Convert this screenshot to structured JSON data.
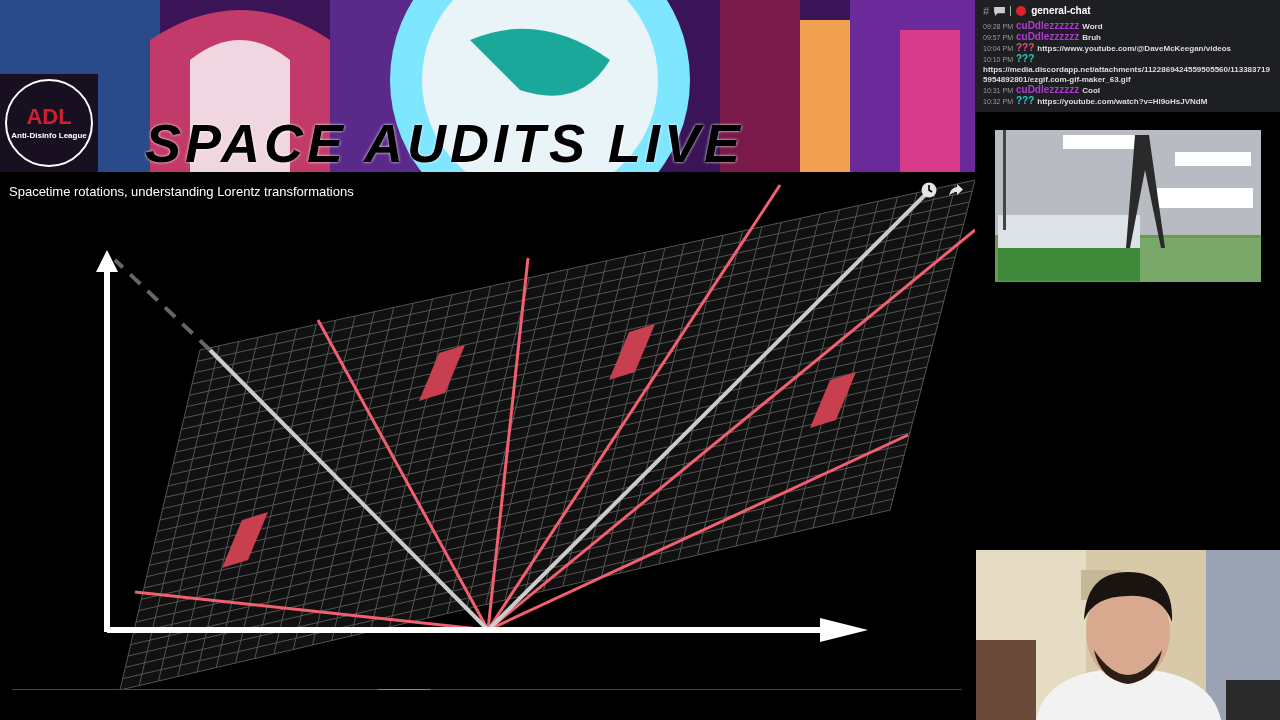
{
  "banner": {
    "logo": {
      "letters": "ADL",
      "caption": "Anti-Disinfo League"
    },
    "title": "SPACE AUDITS LIVE"
  },
  "video": {
    "title": "Spacetime rotations, understanding Lorentz transformations",
    "progress": {
      "level": 0.385
    }
  },
  "chat": {
    "prefix": "#",
    "channel": "general-chat",
    "messages": [
      {
        "kind": "inline",
        "time": "09:28 PM",
        "author": "cuDdlezzzzzz",
        "color": "#b13ad6",
        "text": "Word"
      },
      {
        "kind": "inline",
        "time": "09:57 PM",
        "author": "cuDdlezzzzzz",
        "color": "#b13ad6",
        "text": "Bruh"
      },
      {
        "kind": "inline",
        "time": "10:04 PM",
        "author": "???",
        "color": "#e0557a",
        "text": "https://www.youtube.com/@DaveMcKeegan/videos"
      },
      {
        "kind": "block",
        "time": "10:10 PM",
        "author": "???",
        "color": "#1fd1bd",
        "text": "https://media.discordapp.net/attachments/1122869424559505560/1133837195954892801/ezgif.com-gif-maker_63.gif"
      },
      {
        "kind": "inline",
        "time": "10:31 PM",
        "author": "cuDdlezzzzzz",
        "color": "#b13ad6",
        "text": "Cool"
      },
      {
        "kind": "inline",
        "time": "10:32 PM",
        "author": "???",
        "color": "#1fd1bd",
        "text": "https://youtube.com/watch?v=Hl9oHsJVNdM"
      }
    ]
  }
}
